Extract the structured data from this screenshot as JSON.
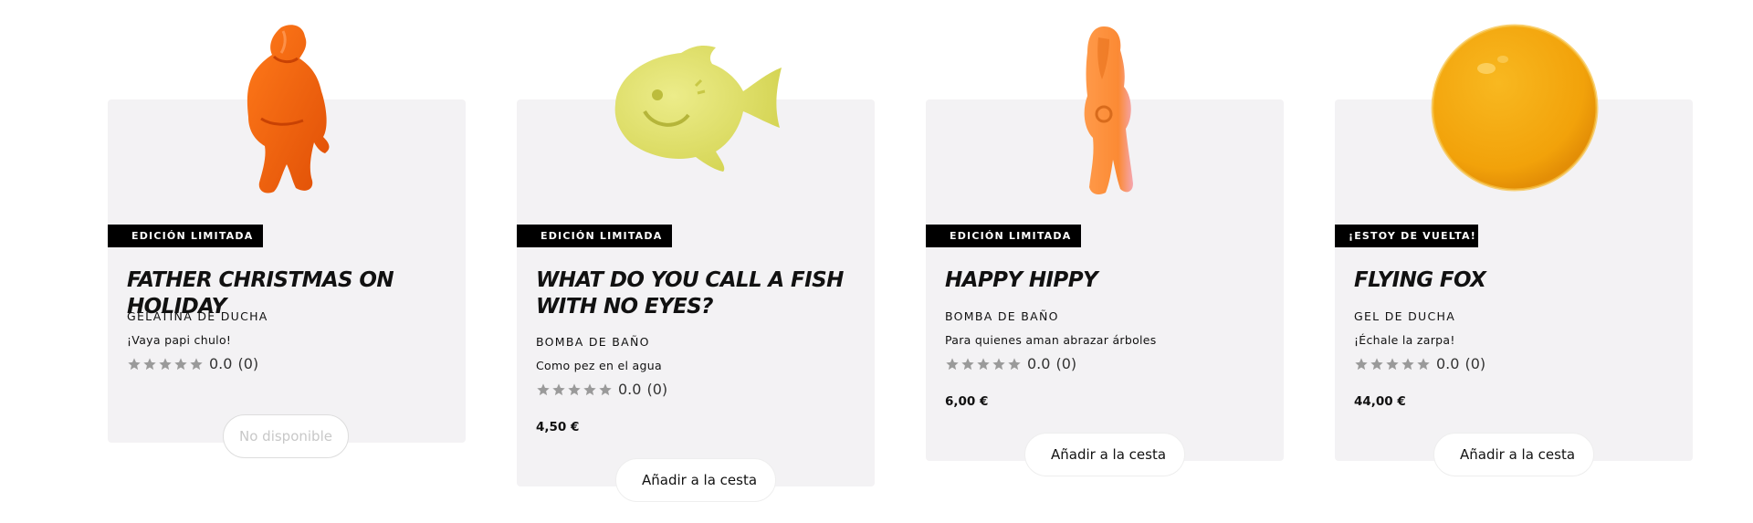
{
  "colors": {
    "card_bg": "#f3f2f4",
    "badge_bg": "#000000",
    "star_gray": "#9a9a9a"
  },
  "products": [
    {
      "badge": "EDICIÓN LIMITADA",
      "badge_icon": "lightning-bolt-icon",
      "title": "FATHER CHRISTMAS ON HOLIDAY",
      "category": "GELATINA DE DUCHA",
      "tagline": "¡Vaya papi chulo!",
      "rating_value": "0.0",
      "rating_count": "(0)",
      "price": "",
      "button_label": "No disponible",
      "available": false
    },
    {
      "badge": "EDICIÓN LIMITADA",
      "badge_icon": "lightning-bolt-icon",
      "title": "WHAT DO YOU CALL A FISH WITH NO EYES?",
      "category": "BOMBA DE BAÑO",
      "tagline": "Como pez en el agua",
      "rating_value": "0.0",
      "rating_count": "(0)",
      "price": "4,50 €",
      "button_label": "Añadir a la cesta",
      "available": true
    },
    {
      "badge": "EDICIÓN LIMITADA",
      "badge_icon": "lightning-bolt-icon",
      "title": "HAPPY HIPPY",
      "category": "BOMBA DE BAÑO",
      "tagline": "Para quienes aman abrazar árboles",
      "rating_value": "0.0",
      "rating_count": "(0)",
      "price": "6,00 €",
      "button_label": "Añadir a la cesta",
      "available": true
    },
    {
      "badge": "¡ESTOY DE VUELTA!",
      "badge_icon": "",
      "title": "FLYING FOX",
      "category": "GEL DE DUCHA",
      "tagline": "¡Échale la zarpa!",
      "rating_value": "0.0",
      "rating_count": "(0)",
      "price": "44,00 €",
      "button_label": "Añadir a la cesta",
      "available": true
    }
  ]
}
